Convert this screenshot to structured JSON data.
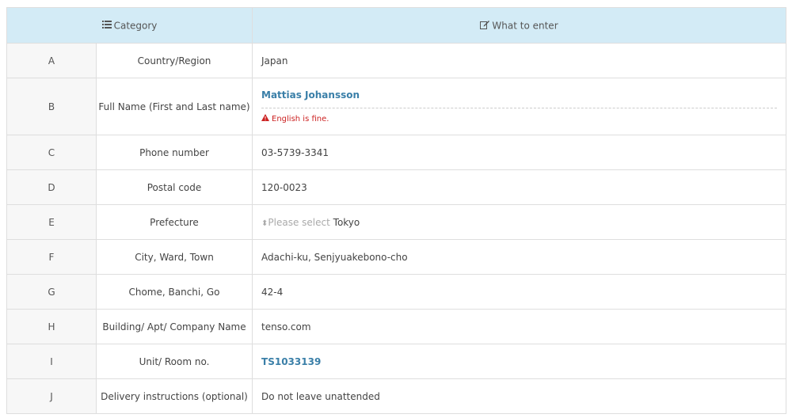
{
  "header": {
    "category_label": "Category",
    "category_icon": "list-icon",
    "what_label": "What to enter",
    "what_icon": "edit-icon"
  },
  "rows": [
    {
      "letter": "A",
      "category": "Country/Region",
      "value": "Japan"
    },
    {
      "letter": "B",
      "category": "Full Name (First and Last name)",
      "value": "Mattias Johansson",
      "note": "English is fine."
    },
    {
      "letter": "C",
      "category": "Phone number",
      "value": "03-5739-3341"
    },
    {
      "letter": "D",
      "category": "Postal code",
      "value": "120-0023"
    },
    {
      "letter": "E",
      "category": "Prefecture",
      "placeholder": "Please select",
      "value": "Tokyo"
    },
    {
      "letter": "F",
      "category": "City, Ward, Town",
      "value": "Adachi-ku, Senjyuakebono-cho"
    },
    {
      "letter": "G",
      "category": "Chome, Banchi, Go",
      "value": "42-4"
    },
    {
      "letter": "H",
      "category": "Building/ Apt/ Company Name",
      "value": "tenso.com"
    },
    {
      "letter": "I",
      "category": "Unit/ Room no.",
      "value": "TS1033139"
    },
    {
      "letter": "J",
      "category": "Delivery instructions (optional)",
      "value": "Do not leave unattended"
    }
  ],
  "colors": {
    "header_bg": "#d3ebf6",
    "letter_bg": "#f7f7f7",
    "accent_blue": "#3a7fa8",
    "warning_red": "#cc2222"
  }
}
